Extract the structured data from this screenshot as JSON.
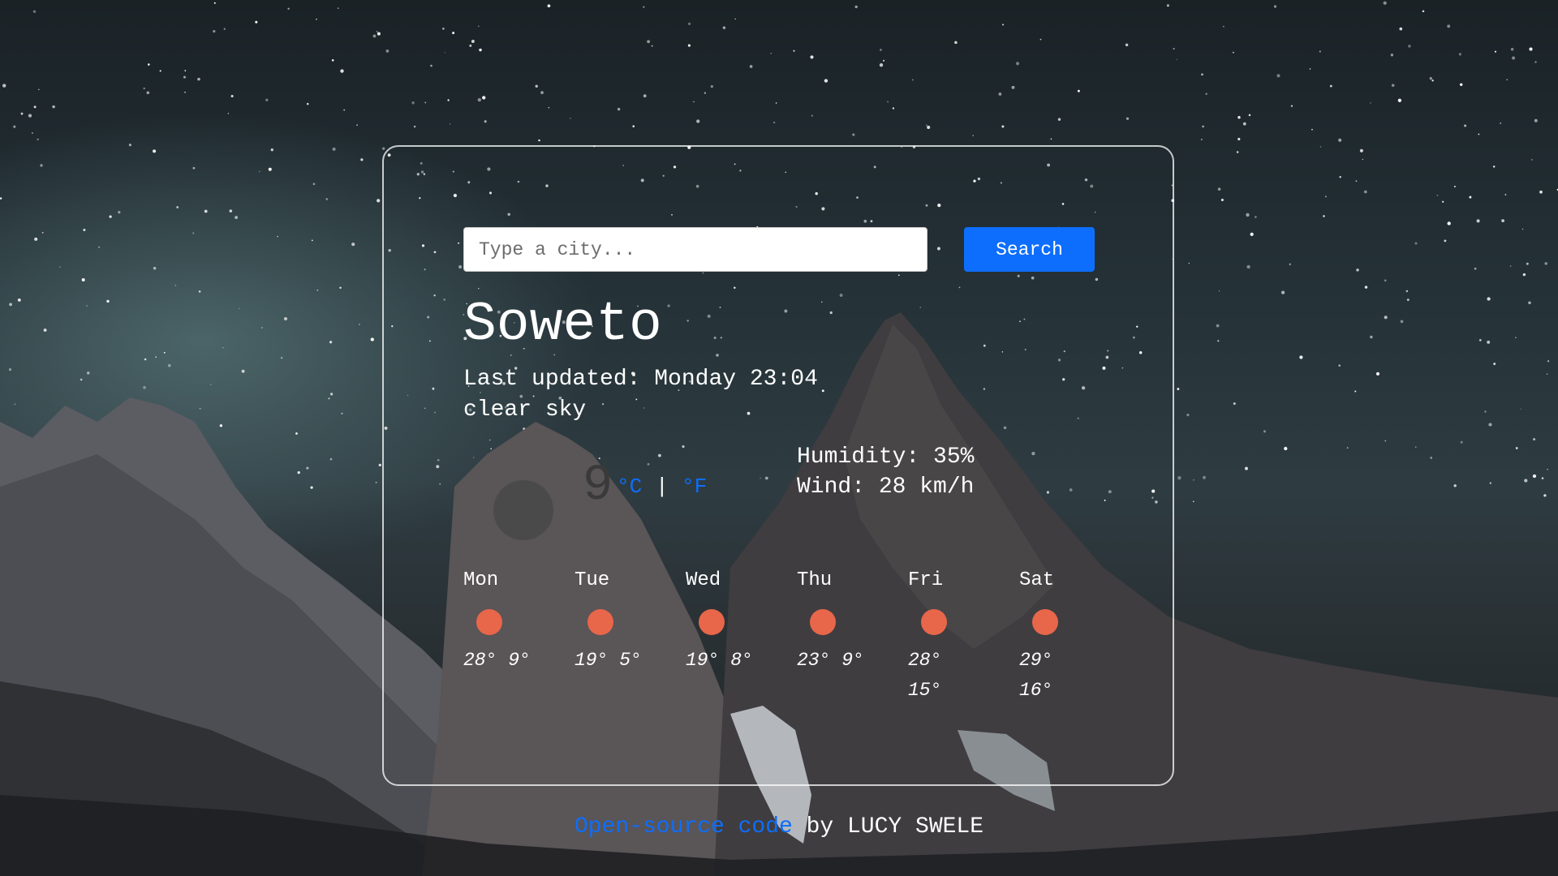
{
  "search": {
    "placeholder": "Type a city...",
    "button_label": "Search"
  },
  "current": {
    "city": "Soweto",
    "last_updated": "Last updated: Monday 23:04",
    "description": "clear sky",
    "temperature": "9",
    "unit_celsius": "°C",
    "unit_separator": "|",
    "unit_fahrenheit": "°F",
    "humidity": "Humidity: 35%",
    "wind": "Wind: 28 km/h",
    "icon": "weather-icon"
  },
  "forecast": [
    {
      "day": "Mon",
      "max": "28°",
      "min": "9°",
      "icon": "sun-icon"
    },
    {
      "day": "Tue",
      "max": "19°",
      "min": "5°",
      "icon": "sun-icon"
    },
    {
      "day": "Wed",
      "max": "19°",
      "min": "8°",
      "icon": "sun-icon"
    },
    {
      "day": "Thu",
      "max": "23°",
      "min": "9°",
      "icon": "sun-icon"
    },
    {
      "day": "Fri",
      "max": "28°",
      "min": "15°",
      "icon": "sun-icon"
    },
    {
      "day": "Sat",
      "max": "29°",
      "min": "16°",
      "icon": "sun-icon"
    }
  ],
  "footer": {
    "link_text": "Open-source code",
    "credit": " by LUCY SWELE"
  },
  "colors": {
    "accent": "#0d6efd",
    "forecast_icon": "#e8664a"
  }
}
